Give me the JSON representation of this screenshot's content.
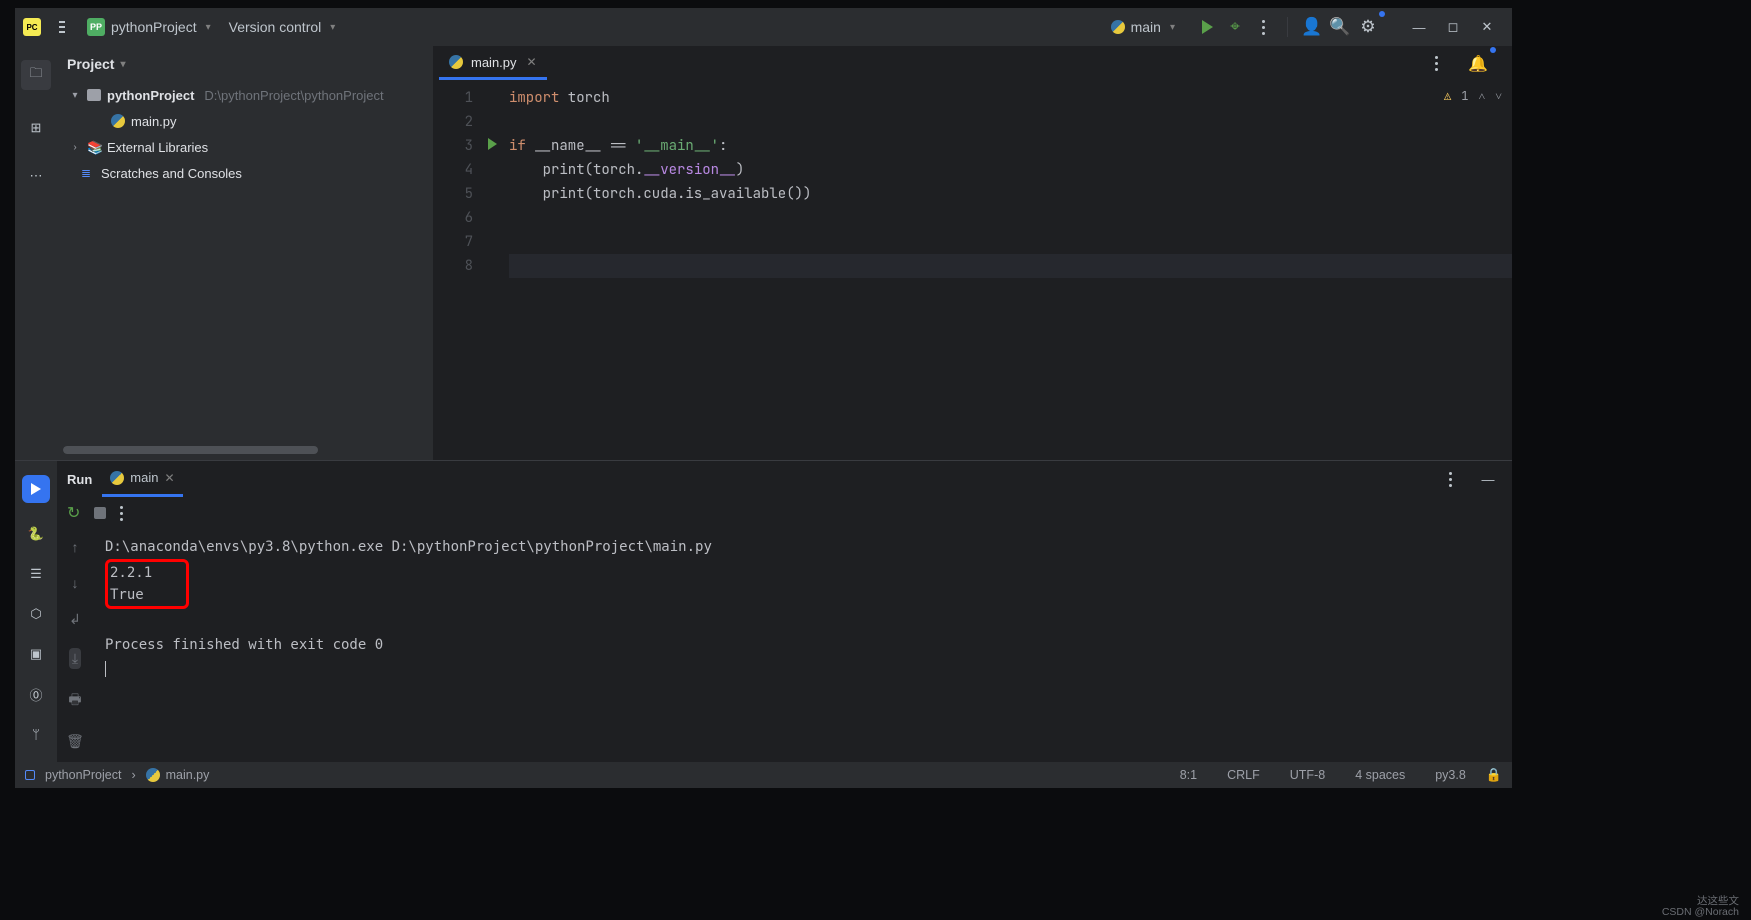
{
  "titlebar": {
    "project_name": "pythonProject",
    "vcs_label": "Version control",
    "run_config": "main"
  },
  "sidebar": {
    "title": "Project",
    "root_name": "pythonProject",
    "root_path": "D:\\pythonProject\\pythonProject",
    "file_main": "main.py",
    "ext_libs": "External Libraries",
    "scratches": "Scratches and Consoles"
  },
  "editor": {
    "tab_name": "main.py",
    "problems_count": "1",
    "gutter_lines": [
      "1",
      "2",
      "3",
      "4",
      "5",
      "6",
      "7",
      "8"
    ],
    "code": {
      "l1_import": "import",
      "l1_mod": " torch",
      "l3_if": "if",
      "l3_name": " __name__ ",
      "l3_eq": "== ",
      "l3_str": "'__main__'",
      "l3_colon": ":",
      "l4_indent": "    ",
      "l4_print": "print",
      "l4_open": "(torch.",
      "l4_ver": "__version__",
      "l4_close": ")",
      "l5_print": "print",
      "l5_body": "(torch.cuda.is_available())"
    }
  },
  "run": {
    "title": "Run",
    "tab": "main",
    "cmd": "D:\\anaconda\\envs\\py3.8\\python.exe D:\\pythonProject\\pythonProject\\main.py",
    "out1": "2.2.1",
    "out2": "True",
    "exitmsg": "Process finished with exit code 0"
  },
  "status": {
    "project": "pythonProject",
    "file": "main.py",
    "linecol": "8:1",
    "linesep": "CRLF",
    "encoding": "UTF-8",
    "indent": "4 spaces",
    "interp": "py3.8"
  },
  "watermark": {
    "l1": "达这些文",
    "l2": "CSDN @Norach"
  }
}
